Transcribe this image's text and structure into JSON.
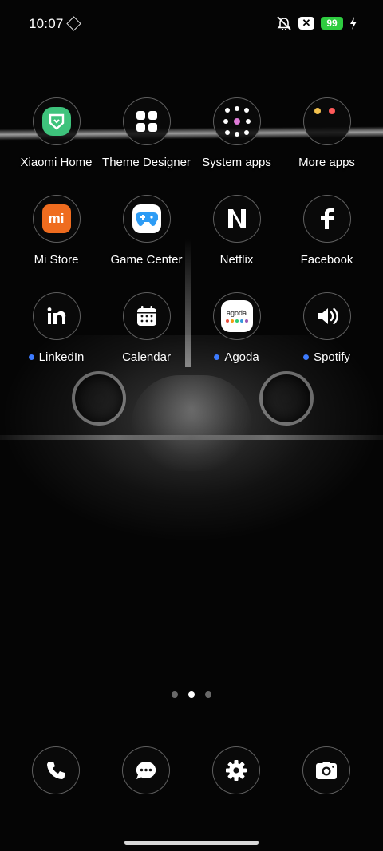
{
  "status": {
    "time": "10:07",
    "battery": "99",
    "icons": [
      "location-diamond-icon",
      "silent-bell-icon",
      "no-sim-icon",
      "battery-icon",
      "charging-bolt-icon"
    ]
  },
  "apps": [
    {
      "label": "Xiaomi Home",
      "icon": "xiaomi-home-icon",
      "dot": false
    },
    {
      "label": "Theme Designer",
      "icon": "grid-four-icon",
      "dot": false
    },
    {
      "label": "System apps",
      "icon": "folder-icon",
      "dot": false
    },
    {
      "label": "More apps",
      "icon": "folder-icon",
      "dot": false
    },
    {
      "label": "Mi Store",
      "icon": "mi-store-icon",
      "dot": false
    },
    {
      "label": "Game Center",
      "icon": "gamepad-icon",
      "dot": false
    },
    {
      "label": "Netflix",
      "icon": "netflix-icon",
      "dot": false
    },
    {
      "label": "Facebook",
      "icon": "facebook-icon",
      "dot": false
    },
    {
      "label": "LinkedIn",
      "icon": "linkedin-icon",
      "dot": true
    },
    {
      "label": "Calendar",
      "icon": "calendar-icon",
      "dot": false
    },
    {
      "label": "Agoda",
      "icon": "agoda-icon",
      "dot": true
    },
    {
      "label": "Spotify",
      "icon": "speaker-icon",
      "dot": true
    }
  ],
  "agoda_text": "agoda",
  "mi_text": "mi",
  "pager": {
    "count": 3,
    "active": 2
  },
  "dock": [
    "phone-icon",
    "messages-icon",
    "settings-icon",
    "camera-icon"
  ],
  "colors": {
    "new_dot": "#3d7bff",
    "battery": "#2ecc40",
    "xiaomi_green": "#3ec37c",
    "mi_orange": "#ef6c1f",
    "game_blue": "#2d9cf5"
  }
}
